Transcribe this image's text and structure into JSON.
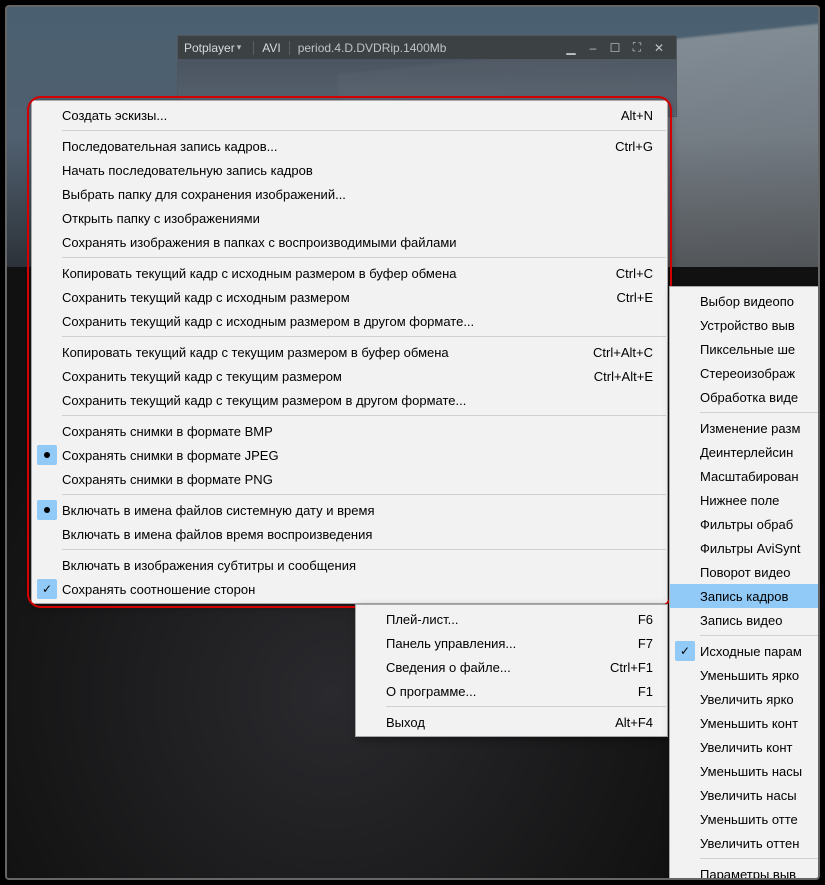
{
  "player": {
    "brand": "Potplayer",
    "format": "AVI",
    "title": "period.4.D.DVDRip.1400Mb",
    "btn_tray": "▁",
    "btn_min": "–",
    "btn_max": "☐",
    "btn_full": "⛶",
    "btn_close": "✕"
  },
  "submenu_left": {
    "groups": [
      [
        {
          "label": "Создать эскизы...",
          "shortcut": "Alt+N"
        }
      ],
      [
        {
          "label": "Последовательная запись кадров...",
          "shortcut": "Ctrl+G"
        },
        {
          "label": "Начать последовательную запись кадров"
        },
        {
          "label": "Выбрать папку для сохранения изображений..."
        },
        {
          "label": "Открыть папку с изображениями"
        },
        {
          "label": "Сохранять изображения в папках с воспроизводимыми файлами"
        }
      ],
      [
        {
          "label": "Копировать текущий кадр с исходным размером в буфер обмена",
          "shortcut": "Ctrl+C"
        },
        {
          "label": "Сохранить текущий кадр с исходным размером",
          "shortcut": "Ctrl+E"
        },
        {
          "label": "Сохранить текущий кадр с исходным размером в другом формате..."
        }
      ],
      [
        {
          "label": "Копировать текущий кадр с текущим размером в буфер обмена",
          "shortcut": "Ctrl+Alt+C"
        },
        {
          "label": "Сохранить текущий кадр с текущим размером",
          "shortcut": "Ctrl+Alt+E"
        },
        {
          "label": "Сохранить текущий кадр с текущим размером в другом формате..."
        }
      ],
      [
        {
          "label": "Сохранять снимки в формате BMP"
        },
        {
          "label": "Сохранять снимки в формате JPEG",
          "radio": true
        },
        {
          "label": "Сохранять снимки в формате PNG"
        }
      ],
      [
        {
          "label": "Включать в имена файлов системную дату и время",
          "radio": true
        },
        {
          "label": "Включать в имена файлов время воспроизведения"
        }
      ],
      [
        {
          "label": "Включать в изображения субтитры и сообщения"
        },
        {
          "label": "Сохранять соотношение сторон",
          "check": true
        }
      ]
    ]
  },
  "menu_bottom": {
    "items": [
      {
        "label": "Плей-лист...",
        "shortcut": "F6"
      },
      {
        "label": "Панель управления...",
        "shortcut": "F7"
      },
      {
        "label": "Сведения о файле...",
        "shortcut": "Ctrl+F1"
      },
      {
        "label": "О программе...",
        "shortcut": "F1"
      }
    ],
    "exit": {
      "label": "Выход",
      "shortcut": "Alt+F4"
    }
  },
  "menu_right": {
    "groups": [
      [
        {
          "label": "Выбор видеопо",
          "arrow": true
        },
        {
          "label": "Устройство выв",
          "arrow": true
        },
        {
          "label": "Пиксельные ше",
          "arrow": true
        },
        {
          "label": "Стереоизображ",
          "arrow": true
        },
        {
          "label": "Обработка виде",
          "arrow": true
        }
      ],
      [
        {
          "label": "Изменение разм",
          "arrow": true
        },
        {
          "label": "Деинтерлейсин",
          "arrow": true
        },
        {
          "label": "Масштабирован",
          "arrow": true
        },
        {
          "label": "Нижнее поле"
        },
        {
          "label": "Фильтры обраб",
          "arrow": true
        },
        {
          "label": "Фильтры AviSynt",
          "arrow": true
        },
        {
          "label": "Поворот видео",
          "arrow": true
        },
        {
          "label": "Запись кадров",
          "arrow": true,
          "highlight": true
        },
        {
          "label": "Запись видео",
          "arrow": true
        }
      ],
      [
        {
          "label": "Исходные парам",
          "check": true
        },
        {
          "label": "Уменьшить ярко"
        },
        {
          "label": "Увеличить ярко"
        },
        {
          "label": "Уменьшить конт"
        },
        {
          "label": "Увеличить конт"
        },
        {
          "label": "Уменьшить насы"
        },
        {
          "label": "Увеличить насы"
        },
        {
          "label": "Уменьшить отте"
        },
        {
          "label": "Увеличить оттен"
        }
      ],
      [
        {
          "label": "Параметры выв"
        }
      ]
    ]
  }
}
